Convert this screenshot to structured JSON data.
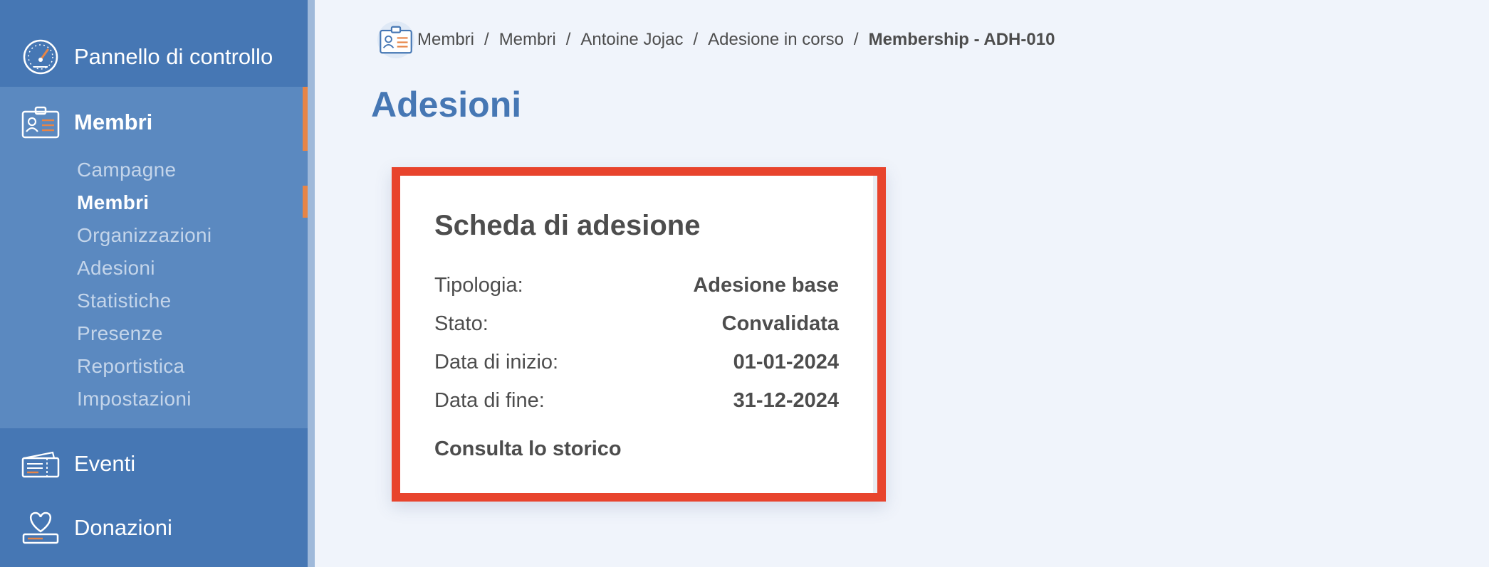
{
  "sidebar": {
    "dashboard": {
      "label": "Pannello di controllo",
      "icon": "dashboard-gauge-icon"
    },
    "members": {
      "label": "Membri",
      "icon": "member-card-icon"
    },
    "sub_items": [
      {
        "label": "Campagne",
        "active": false
      },
      {
        "label": "Membri",
        "active": true
      },
      {
        "label": "Organizzazioni",
        "active": false
      },
      {
        "label": "Adesioni",
        "active": false
      },
      {
        "label": "Statistiche",
        "active": false
      },
      {
        "label": "Presenze",
        "active": false
      },
      {
        "label": "Reportistica",
        "active": false
      },
      {
        "label": "Impostazioni",
        "active": false
      }
    ],
    "events": {
      "label": "Eventi",
      "icon": "ticket-icon"
    },
    "donations": {
      "label": "Donazioni",
      "icon": "heart-hand-icon"
    }
  },
  "breadcrumb": {
    "icon": "member-card-icon",
    "items": [
      "Membri",
      "Membri",
      "Antoine Jojac",
      "Adesione in corso"
    ],
    "current": "Membership - ADH-010",
    "separator": "/"
  },
  "page": {
    "title": "Adesioni"
  },
  "card": {
    "title": "Scheda di adesione",
    "rows": [
      {
        "label": "Tipologia:",
        "value": "Adesione base"
      },
      {
        "label": "Stato:",
        "value": "Convalidata"
      },
      {
        "label": "Data di inizio:",
        "value": "01-01-2024"
      },
      {
        "label": "Data di fine:",
        "value": "31-12-2024"
      }
    ],
    "history_link": "Consulta lo storico"
  },
  "colors": {
    "sidebar": "#4677b4",
    "sidebar_active_block": "#5b89c0",
    "accent": "#e78547",
    "highlight_border": "#e8442d",
    "title": "#4677b4"
  }
}
